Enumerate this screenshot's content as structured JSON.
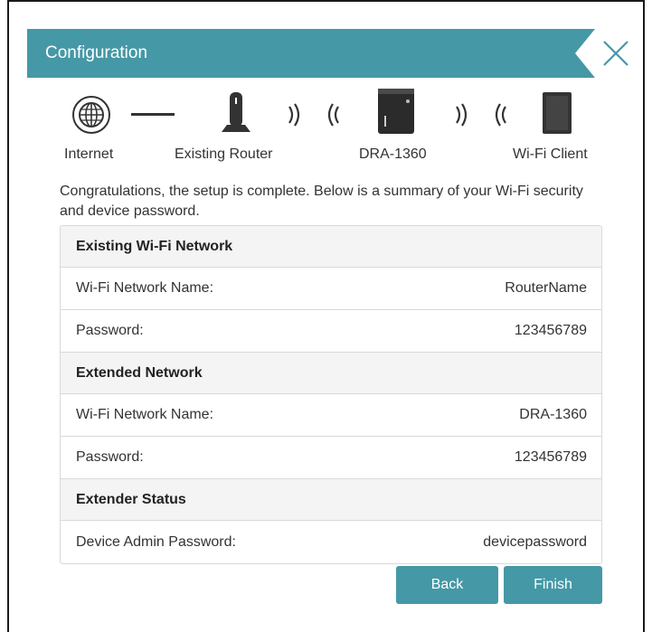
{
  "header": {
    "title": "Configuration"
  },
  "topology": {
    "nodes": [
      {
        "label": "Internet",
        "icon": "globe-icon"
      },
      {
        "label": "Existing Router",
        "icon": "router-icon"
      },
      {
        "label": "DRA-1360",
        "icon": "extender-icon"
      },
      {
        "label": "Wi-Fi Client",
        "icon": "tablet-icon"
      }
    ]
  },
  "intro_text": "Congratulations, the setup is complete. Below is a summary of your Wi-Fi security and device password.",
  "sections": [
    {
      "title": "Existing Wi-Fi Network",
      "rows": [
        {
          "label": "Wi-Fi Network Name:",
          "value": "RouterName"
        },
        {
          "label": "Password:",
          "value": "123456789"
        }
      ]
    },
    {
      "title": "Extended Network",
      "rows": [
        {
          "label": "Wi-Fi Network Name:",
          "value": "DRA-1360"
        },
        {
          "label": "Password:",
          "value": "123456789"
        }
      ]
    },
    {
      "title": "Extender Status",
      "rows": [
        {
          "label": "Device Admin Password:",
          "value": "devicepassword"
        }
      ]
    }
  ],
  "buttons": {
    "back": "Back",
    "finish": "Finish"
  },
  "colors": {
    "accent": "#4598a6",
    "text": "#333333",
    "section_bg": "#f4f4f4",
    "border": "#d9d9d9"
  }
}
